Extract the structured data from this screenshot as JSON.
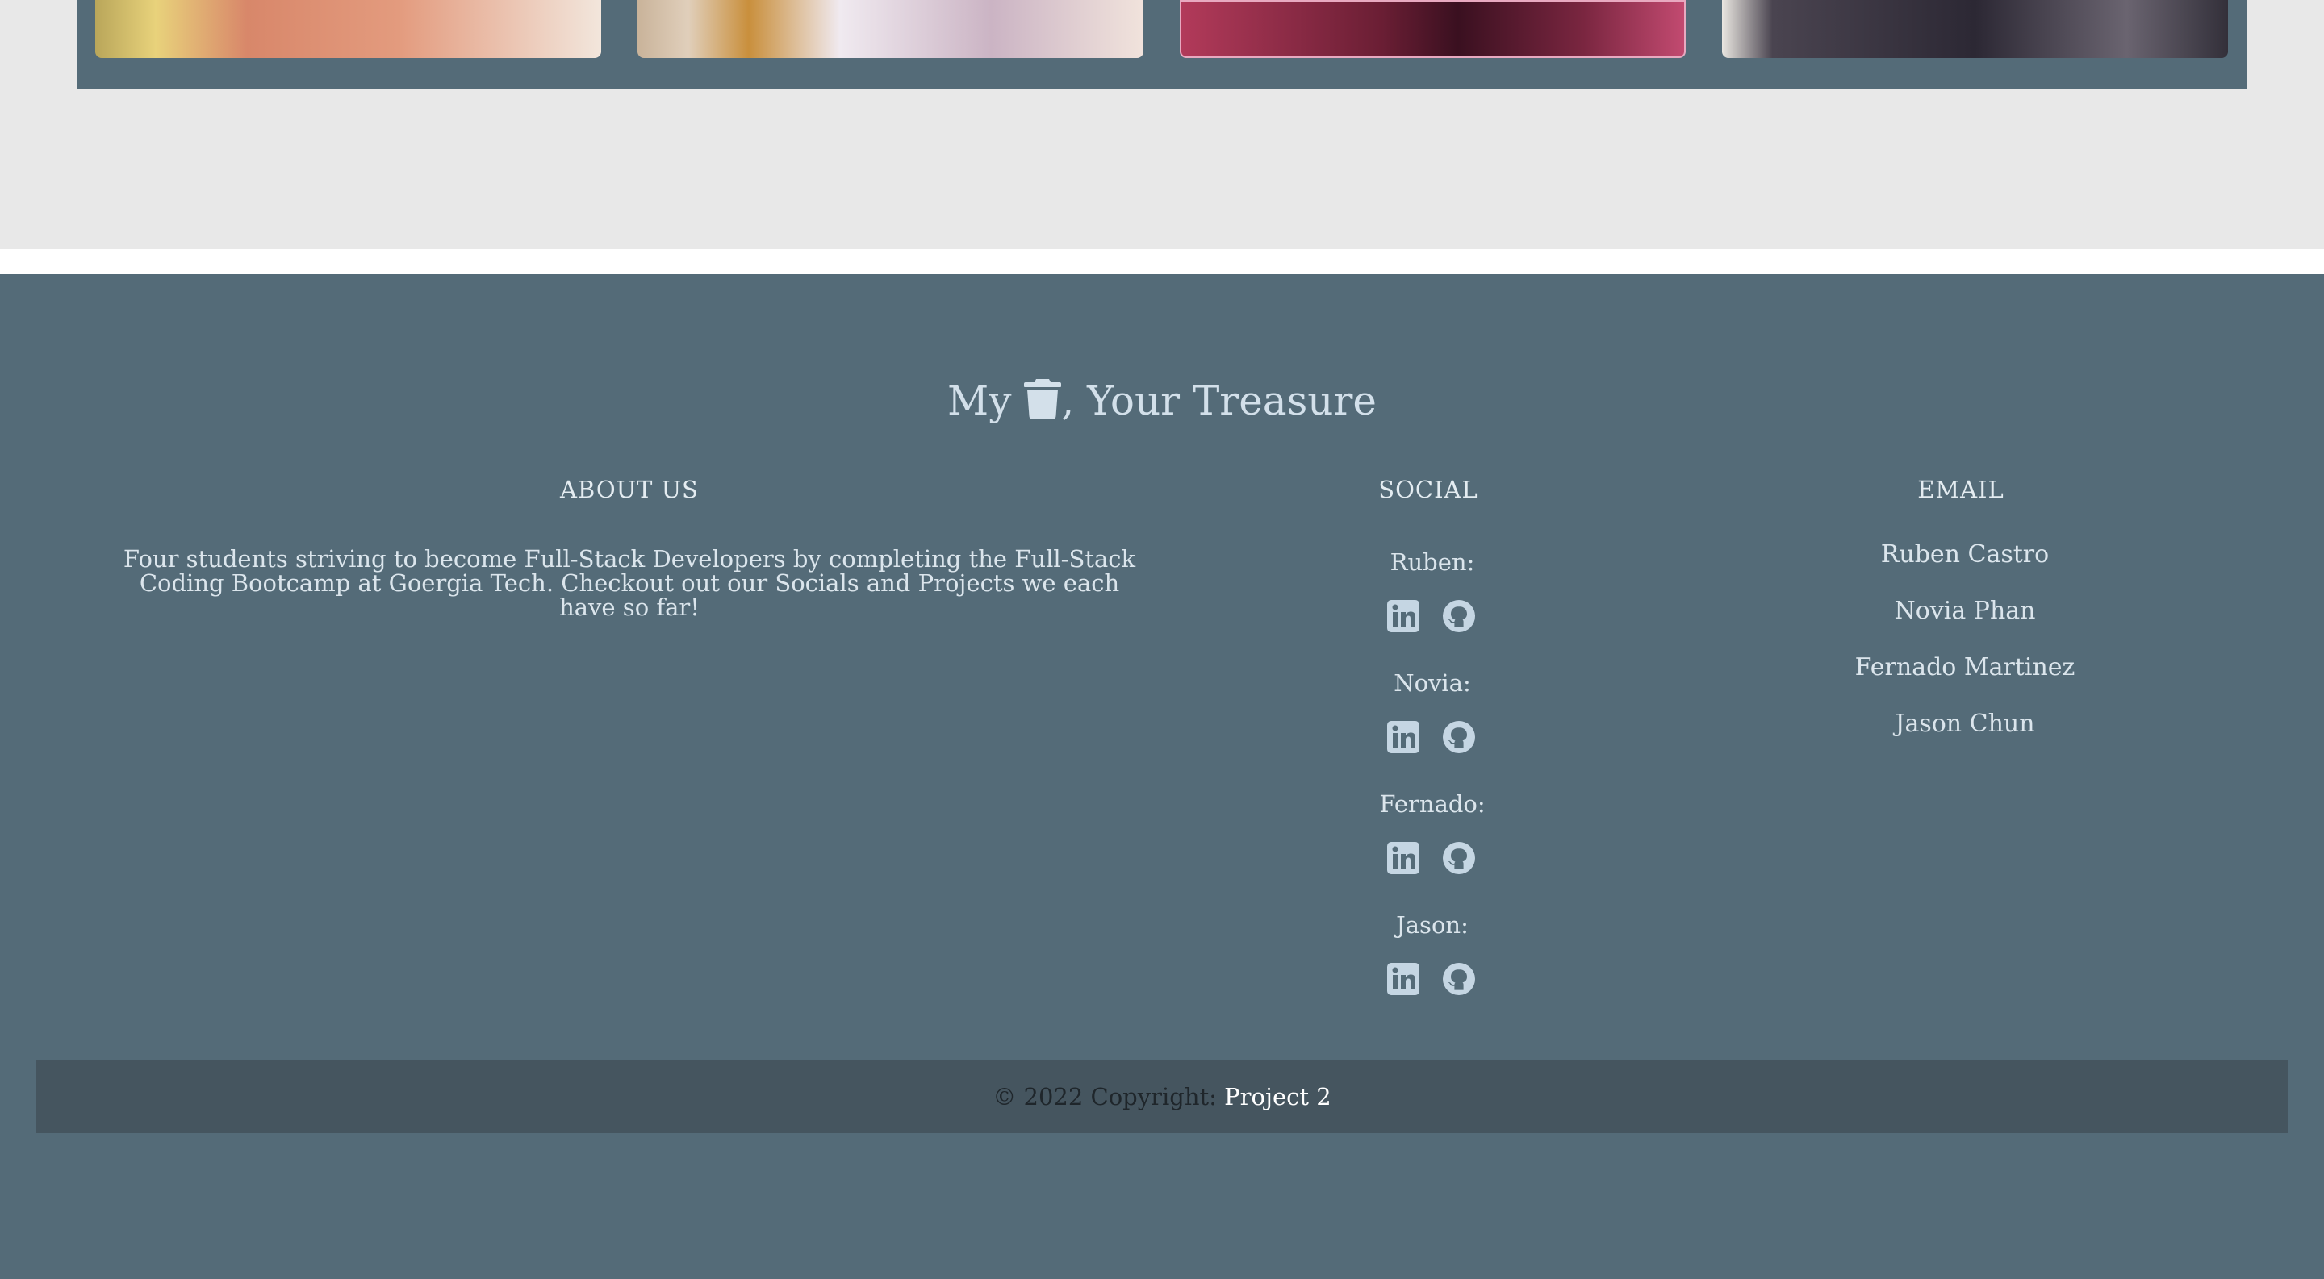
{
  "gallery": {
    "images": [
      {
        "name": "gallery-image-1"
      },
      {
        "name": "gallery-image-2"
      },
      {
        "name": "gallery-image-3"
      },
      {
        "name": "gallery-image-4"
      }
    ]
  },
  "footer": {
    "brand_prefix": "My",
    "brand_icon": "trash-icon",
    "brand_suffix": ", Your Treasure",
    "about": {
      "heading": "ABOUT US",
      "text": "Four students striving to become Full-Stack Developers by completing the Full-Stack Coding Bootcamp at Goergia Tech. Checkout out our Socials and Projects we each have so far!"
    },
    "social": {
      "heading": "SOCIAL",
      "people": [
        {
          "label": "Ruben:",
          "icons": [
            "linkedin-icon",
            "github-icon"
          ]
        },
        {
          "label": "Novia:",
          "icons": [
            "linkedin-icon",
            "github-icon"
          ]
        },
        {
          "label": "Fernado:",
          "icons": [
            "linkedin-icon",
            "github-icon"
          ]
        },
        {
          "label": "Jason:",
          "icons": [
            "linkedin-icon",
            "github-icon"
          ]
        }
      ]
    },
    "email": {
      "heading": "EMAIL",
      "links": [
        "Ruben Castro",
        "Novia Phan",
        "Fernado Martinez",
        "Jason Chun"
      ]
    },
    "copyright": {
      "text": "© 2022 Copyright:",
      "link": "Project 2"
    }
  },
  "colors": {
    "footer_bg": "#546b78",
    "copyright_bg": "#45555f",
    "page_bg": "#e8e8e8",
    "text_light": "#dbe5ec"
  }
}
